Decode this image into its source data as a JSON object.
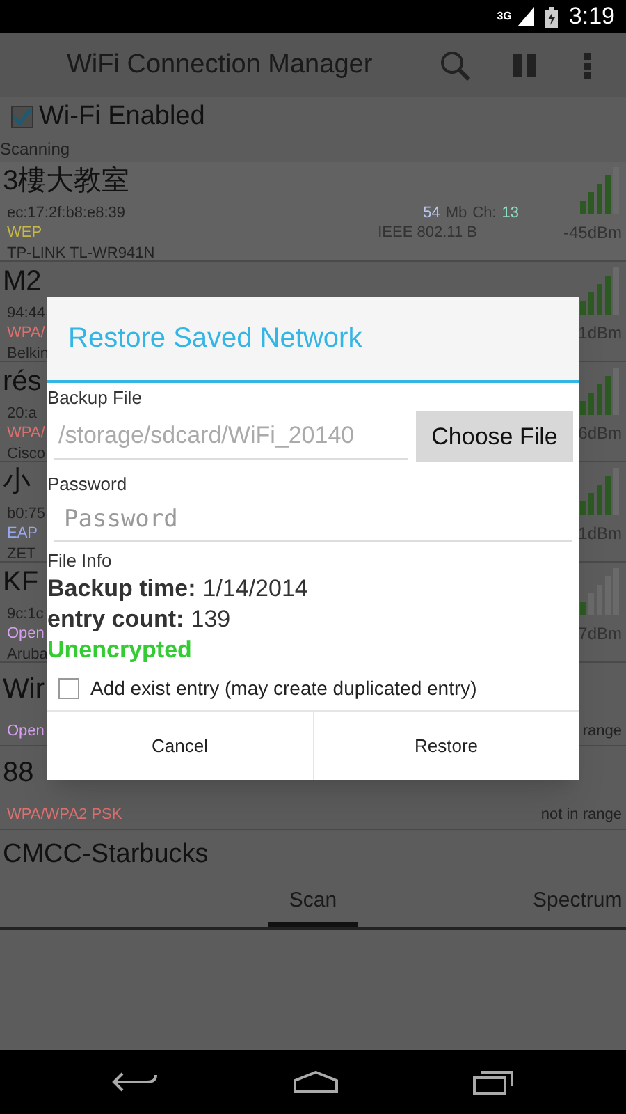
{
  "status_bar": {
    "network": "3G",
    "time": "3:19"
  },
  "action_bar": {
    "title": "WiFi Connection Manager"
  },
  "wifi_toggle": {
    "label": "Wi-Fi Enabled",
    "checked": true
  },
  "status_text": "Scanning",
  "networks": [
    {
      "kind": "full",
      "name": "3樓大教室",
      "mac": "ec:17:2f:b8:e8:39",
      "rate": "54",
      "rate_unit": "Mb",
      "channel_label": "Ch:",
      "channel": "13",
      "security": {
        "text": "WEP",
        "color": "#c8b848"
      },
      "standard": "IEEE 802.11 B",
      "vendor": "TP-LINK TL-WR941N",
      "signal_text": "-45dBm"
    },
    {
      "kind": "partial",
      "name": "M2",
      "mac": "94:44",
      "security": {
        "text": "WPA/",
        "color": "#e07070"
      },
      "vendor": "Belkin",
      "signal_text": "1dBm"
    },
    {
      "kind": "partial",
      "name": "rés",
      "mac": "20:a",
      "security": {
        "text": "WPA/",
        "color": "#e07070"
      },
      "vendor": "Cisco",
      "signal_text": "6dBm"
    },
    {
      "kind": "partial",
      "name": "小",
      "mac": "b0:75",
      "security": {
        "text": "EAP",
        "color": "#98a8f0"
      },
      "vendor": "ZET",
      "signal_text": "1dBm"
    },
    {
      "kind": "partial",
      "name": "KF",
      "mac": "9c:1c",
      "security": {
        "text": "Open",
        "color": "#d8a0f0"
      },
      "vendor": "Aruba",
      "signal_text": "7dBm"
    },
    {
      "kind": "out",
      "name": "Wir",
      "security": {
        "text": "Open",
        "color": "#d8a0f0"
      },
      "signal_text": "range"
    },
    {
      "kind": "out",
      "name": "88",
      "security": {
        "text": "WPA/WPA2 PSK",
        "color": "#e07070"
      },
      "signal_text": "not in range"
    },
    {
      "kind": "name",
      "name": "CMCC-Starbucks"
    }
  ],
  "tabs": [
    {
      "label": "Scan",
      "selected": true
    },
    {
      "label": "Spectrum",
      "selected": false
    }
  ],
  "dialog": {
    "title": "Restore Saved Network",
    "backup_label": "Backup File",
    "backup_value": "/storage/sdcard/WiFi_20140",
    "choose_button": "Choose File",
    "password_label": "Password",
    "password_placeholder": "Password",
    "info_label": "File Info",
    "info": [
      {
        "label": "Backup time:",
        "value": "1/14/2014"
      },
      {
        "label": "entry count:",
        "value": "139"
      }
    ],
    "encryption": "Unencrypted",
    "add_entry": {
      "label": "Add exist entry (may create duplicated entry)",
      "checked": false
    },
    "buttons": [
      "Cancel",
      "Restore"
    ]
  }
}
